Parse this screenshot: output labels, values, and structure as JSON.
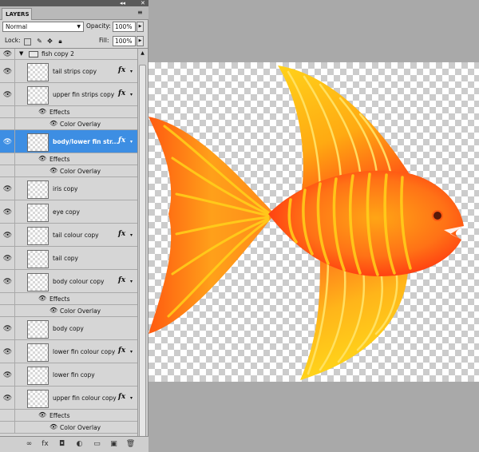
{
  "panel": {
    "tab_label": "LAYERS",
    "title_controls": [
      "◂◂",
      "✕"
    ],
    "blend_mode": "Normal",
    "opacity_label": "Opacity:",
    "opacity_value": "100%",
    "lock_label": "Lock:",
    "fill_label": "Fill:",
    "fill_value": "100%"
  },
  "layers": [
    {
      "name": "fish copy 2",
      "type": "group"
    },
    {
      "name": "tail strips copy",
      "fx": "fx"
    },
    {
      "name": "upper fin strips copy",
      "fx": "fx"
    },
    {
      "name": "Effects",
      "type": "effects"
    },
    {
      "name": "Color Overlay",
      "type": "overlay"
    },
    {
      "name": "body/lower fin str...",
      "fx": "fx",
      "selected": true
    },
    {
      "name": "Effects",
      "type": "effects"
    },
    {
      "name": "Color Overlay",
      "type": "overlay"
    },
    {
      "name": "iris copy"
    },
    {
      "name": "eye copy"
    },
    {
      "name": "tail colour copy",
      "fx": "fx"
    },
    {
      "name": "tail copy"
    },
    {
      "name": "body colour copy",
      "fx": "fx"
    },
    {
      "name": "Effects",
      "type": "effects"
    },
    {
      "name": "Color Overlay",
      "type": "overlay"
    },
    {
      "name": "body copy"
    },
    {
      "name": "lower fin colour copy",
      "fx": "fx"
    },
    {
      "name": "lower fin copy"
    },
    {
      "name": "upper fin colour copy",
      "fx": "fx"
    },
    {
      "name": "Effects",
      "type": "effects"
    },
    {
      "name": "Color Overlay",
      "type": "overlay"
    }
  ],
  "bottom_icons": [
    "link-icon",
    "fx-icon",
    "mask-icon",
    "adjustment-icon",
    "folder-icon",
    "new-layer-icon",
    "trash-icon"
  ],
  "bottom_icon_glyphs": [
    "∞",
    "fx",
    "◘",
    "◐",
    "▭",
    "▣",
    "🗑"
  ],
  "colors": {
    "fish_orange": "#ff7a1f",
    "fish_yellow": "#ffd21a",
    "fish_red": "#ff3b10",
    "selection_blue": "#3d8ee3"
  }
}
